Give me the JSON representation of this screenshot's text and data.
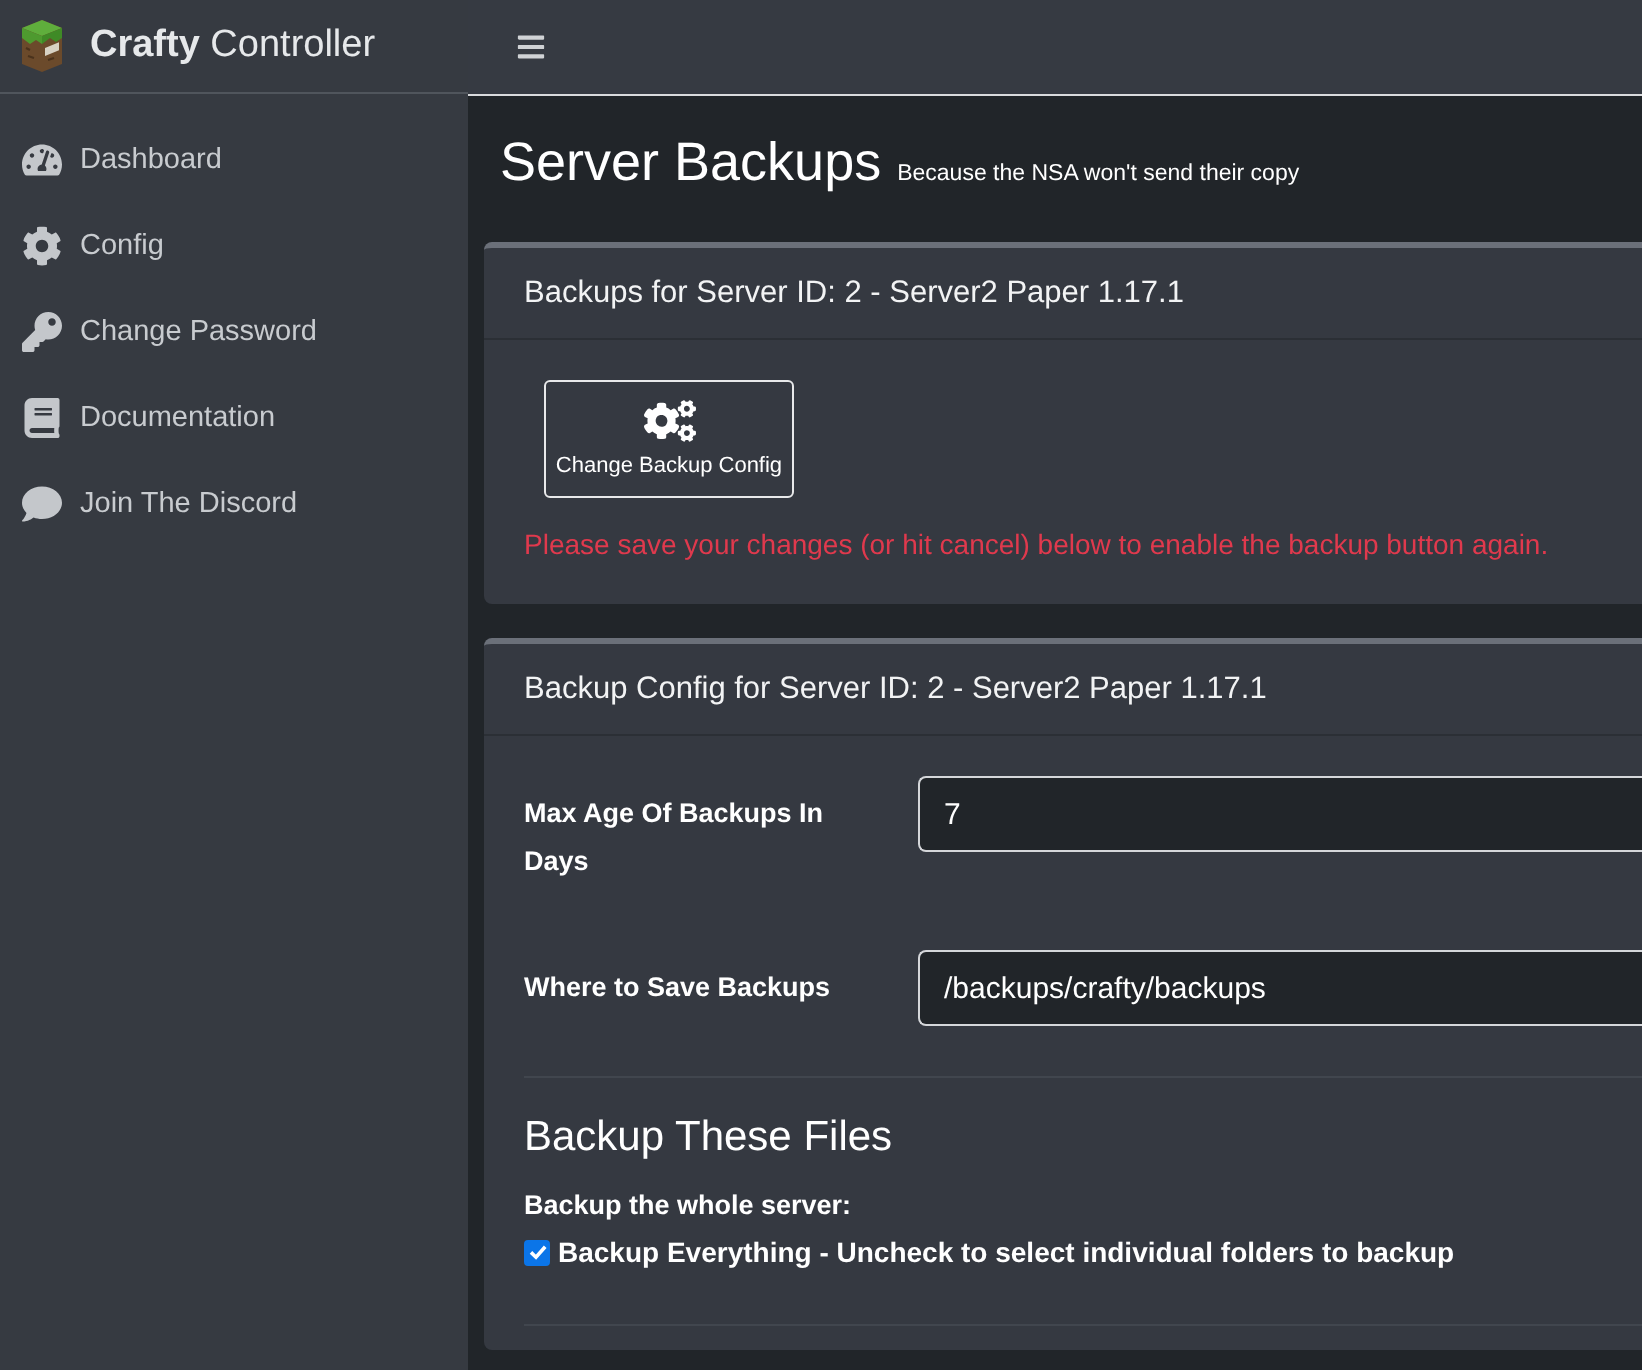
{
  "brand": {
    "title": "**Crafty** Controller"
  },
  "sidebar": {
    "items": [
      {
        "label": "Dashboard"
      },
      {
        "label": "Config"
      },
      {
        "label": "Change Password"
      },
      {
        "label": "Documentation"
      },
      {
        "label": "Join The Discord"
      }
    ]
  },
  "page": {
    "title": "Server Backups",
    "subtitle": "Because the NSA won't send their copy"
  },
  "backups_card": {
    "header": "Backups for Server ID: 2 - Server2 Paper 1.17.1",
    "button": {
      "label": "Change Backup Config"
    },
    "warning": "Please save your changes (or hit cancel) below to enable the backup button again."
  },
  "config_card": {
    "header": "Backup Config for Server ID: 2 - Server2 Paper 1.17.1",
    "fields": [
      {
        "label": "Max Age Of Backups In Days",
        "value": "7"
      },
      {
        "label": "Where to Save Backups",
        "value": "/backups/crafty/backups"
      }
    ],
    "section_title": "Backup These Files",
    "group_label": "Backup the whole server:",
    "checkbox": {
      "label": "Backup Everything - Uncheck to select individual folders to backup",
      "checked": true
    }
  }
}
